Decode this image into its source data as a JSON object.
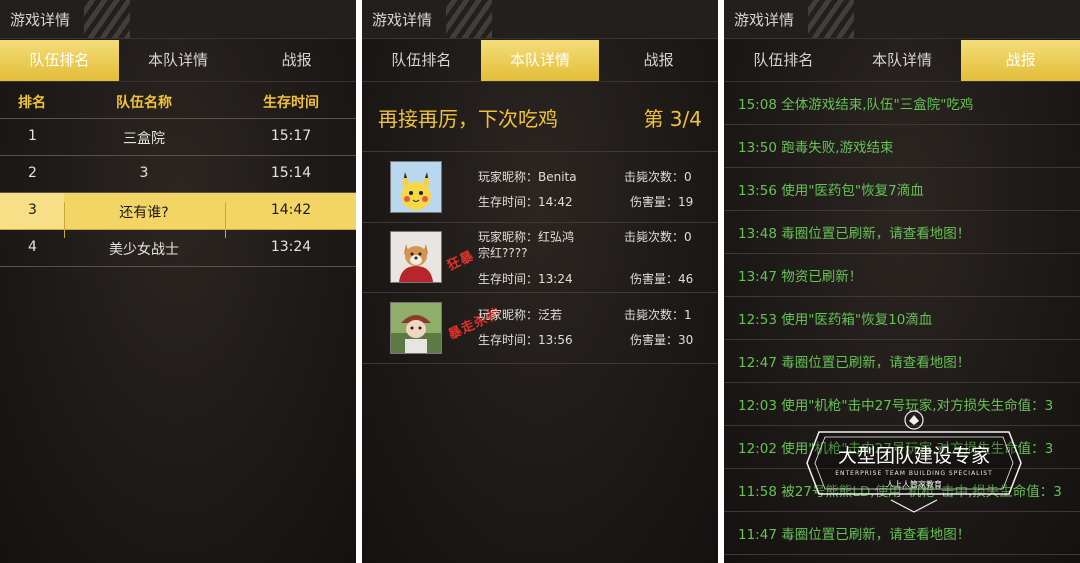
{
  "panels": [
    {
      "title": "游戏详情",
      "tabs": [
        "队伍排名",
        "本队详情",
        "战报"
      ],
      "active_tab": 0,
      "columns": [
        "排名",
        "队伍名称",
        "生存时间"
      ],
      "rows": [
        {
          "rank": "1",
          "name": "三盒院",
          "time": "15:17",
          "highlight": false
        },
        {
          "rank": "2",
          "name": "3",
          "time": "15:14",
          "highlight": false
        },
        {
          "rank": "3",
          "name": "还有谁?",
          "time": "14:42",
          "highlight": true
        },
        {
          "rank": "4",
          "name": "美少女战士",
          "time": "13:24",
          "highlight": false
        }
      ]
    },
    {
      "title": "游戏详情",
      "tabs": [
        "队伍排名",
        "本队详情",
        "战报"
      ],
      "active_tab": 1,
      "headline": "再接再厉，下次吃鸡",
      "rank_text": "第 3/4",
      "players": [
        {
          "nick_label": "玩家昵称：Benita",
          "time_label": "生存时间：14:42",
          "kills_label": "击毙次数：0",
          "damage_label": "伤害量：19",
          "stamp": "",
          "avatar": "pikachu-avatar"
        },
        {
          "nick_label": "玩家昵称：红弘鸿",
          "nick_cont": "宗红????",
          "time_label": "生存时间：13:24",
          "kills_label": "击毙次数：0",
          "damage_label": "伤害量：46",
          "stamp": "狂暴",
          "avatar": "dog-avatar"
        },
        {
          "nick_label": "玩家昵称：泛若",
          "time_label": "生存时间：13:56",
          "kills_label": "击毙次数：1",
          "damage_label": "伤害量：30",
          "stamp": "暴走杀神",
          "avatar": "kid-avatar"
        }
      ]
    },
    {
      "title": "游戏详情",
      "tabs": [
        "队伍排名",
        "本队详情",
        "战报"
      ],
      "active_tab": 2,
      "events": [
        "15:08 全体游戏结束,队伍\"三盒院\"吃鸡",
        "13:50 跑毒失败,游戏结束",
        "13:56 使用\"医药包\"恢复7滴血",
        "13:48 毒圈位置已刷新，请查看地图！",
        "13:47 物资已刷新！",
        "12:53 使用\"医药箱\"恢复10滴血",
        "12:47 毒圈位置已刷新，请查看地图！",
        "12:03 使用\"机枪\"击中27号玩家,对方损失生命值：3",
        "12:02 使用\"机枪\"击中27号玩家,对方损失生命值：3",
        "11:58 被27号熊熊LD,使用\"机枪\"击中,损失生命值：3",
        "11:47 毒圈位置已刷新，请查看地图！"
      ]
    }
  ],
  "watermark": {
    "title": "大型团队建设专家",
    "subtitle": "ENTERPRISE TEAM BUILDING SPECIALIST",
    "brand": "人上人管家教育"
  },
  "colors": {
    "gold": "#f0c23a",
    "highlight": "#f2d565",
    "green_text": "#66c255",
    "stamp_red": "#e0312b"
  }
}
